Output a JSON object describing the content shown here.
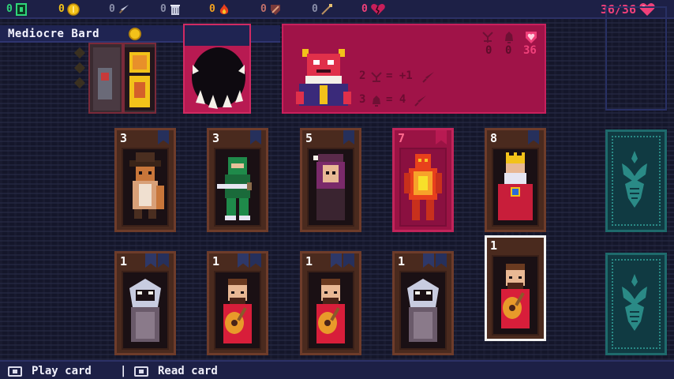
{
  "stats": {
    "cards": {
      "value": "0",
      "color": "#2fd67a",
      "icon": "card-icon"
    },
    "gold": {
      "value": "0",
      "color": "#f2c21a",
      "icon": "coin-icon"
    },
    "swords": {
      "value": "0",
      "icon": "sword-icon"
    },
    "bins": {
      "value": "0",
      "icon": "trash-bin-icon"
    },
    "fire": {
      "value": "0",
      "icon": "fire-icon"
    },
    "shields": {
      "value": "0",
      "icon": "shield-icon"
    },
    "wands": {
      "value": "0",
      "icon": "wand-icon"
    },
    "hearts": {
      "value": "0",
      "icon": "broken-heart-icon"
    },
    "health": "36/36",
    "accent": "#f0407a"
  },
  "character": {
    "name": "Mediocre Bard"
  },
  "encounter": {
    "counters": [
      "0",
      "0",
      "36"
    ],
    "rules": [
      {
        "count": "2",
        "result": "= +1"
      },
      {
        "count": "3",
        "result": "= 4"
      }
    ]
  },
  "market_cards": [
    {
      "cost": "3",
      "subject": "cowboy-fox"
    },
    {
      "cost": "3",
      "subject": "green-ninja"
    },
    {
      "cost": "5",
      "subject": "purple-witch"
    },
    {
      "cost": "7",
      "subject": "fire-demon"
    },
    {
      "cost": "8",
      "subject": "king"
    }
  ],
  "hand_cards": [
    {
      "cost": "1",
      "subject": "hooded-ghost"
    },
    {
      "cost": "1",
      "subject": "bard"
    },
    {
      "cost": "1",
      "subject": "bard"
    },
    {
      "cost": "1",
      "subject": "hooded-ghost"
    },
    {
      "cost": "1",
      "subject": "bard"
    }
  ],
  "hints": {
    "play": "Play card",
    "separator": "|",
    "read": "Read card"
  }
}
